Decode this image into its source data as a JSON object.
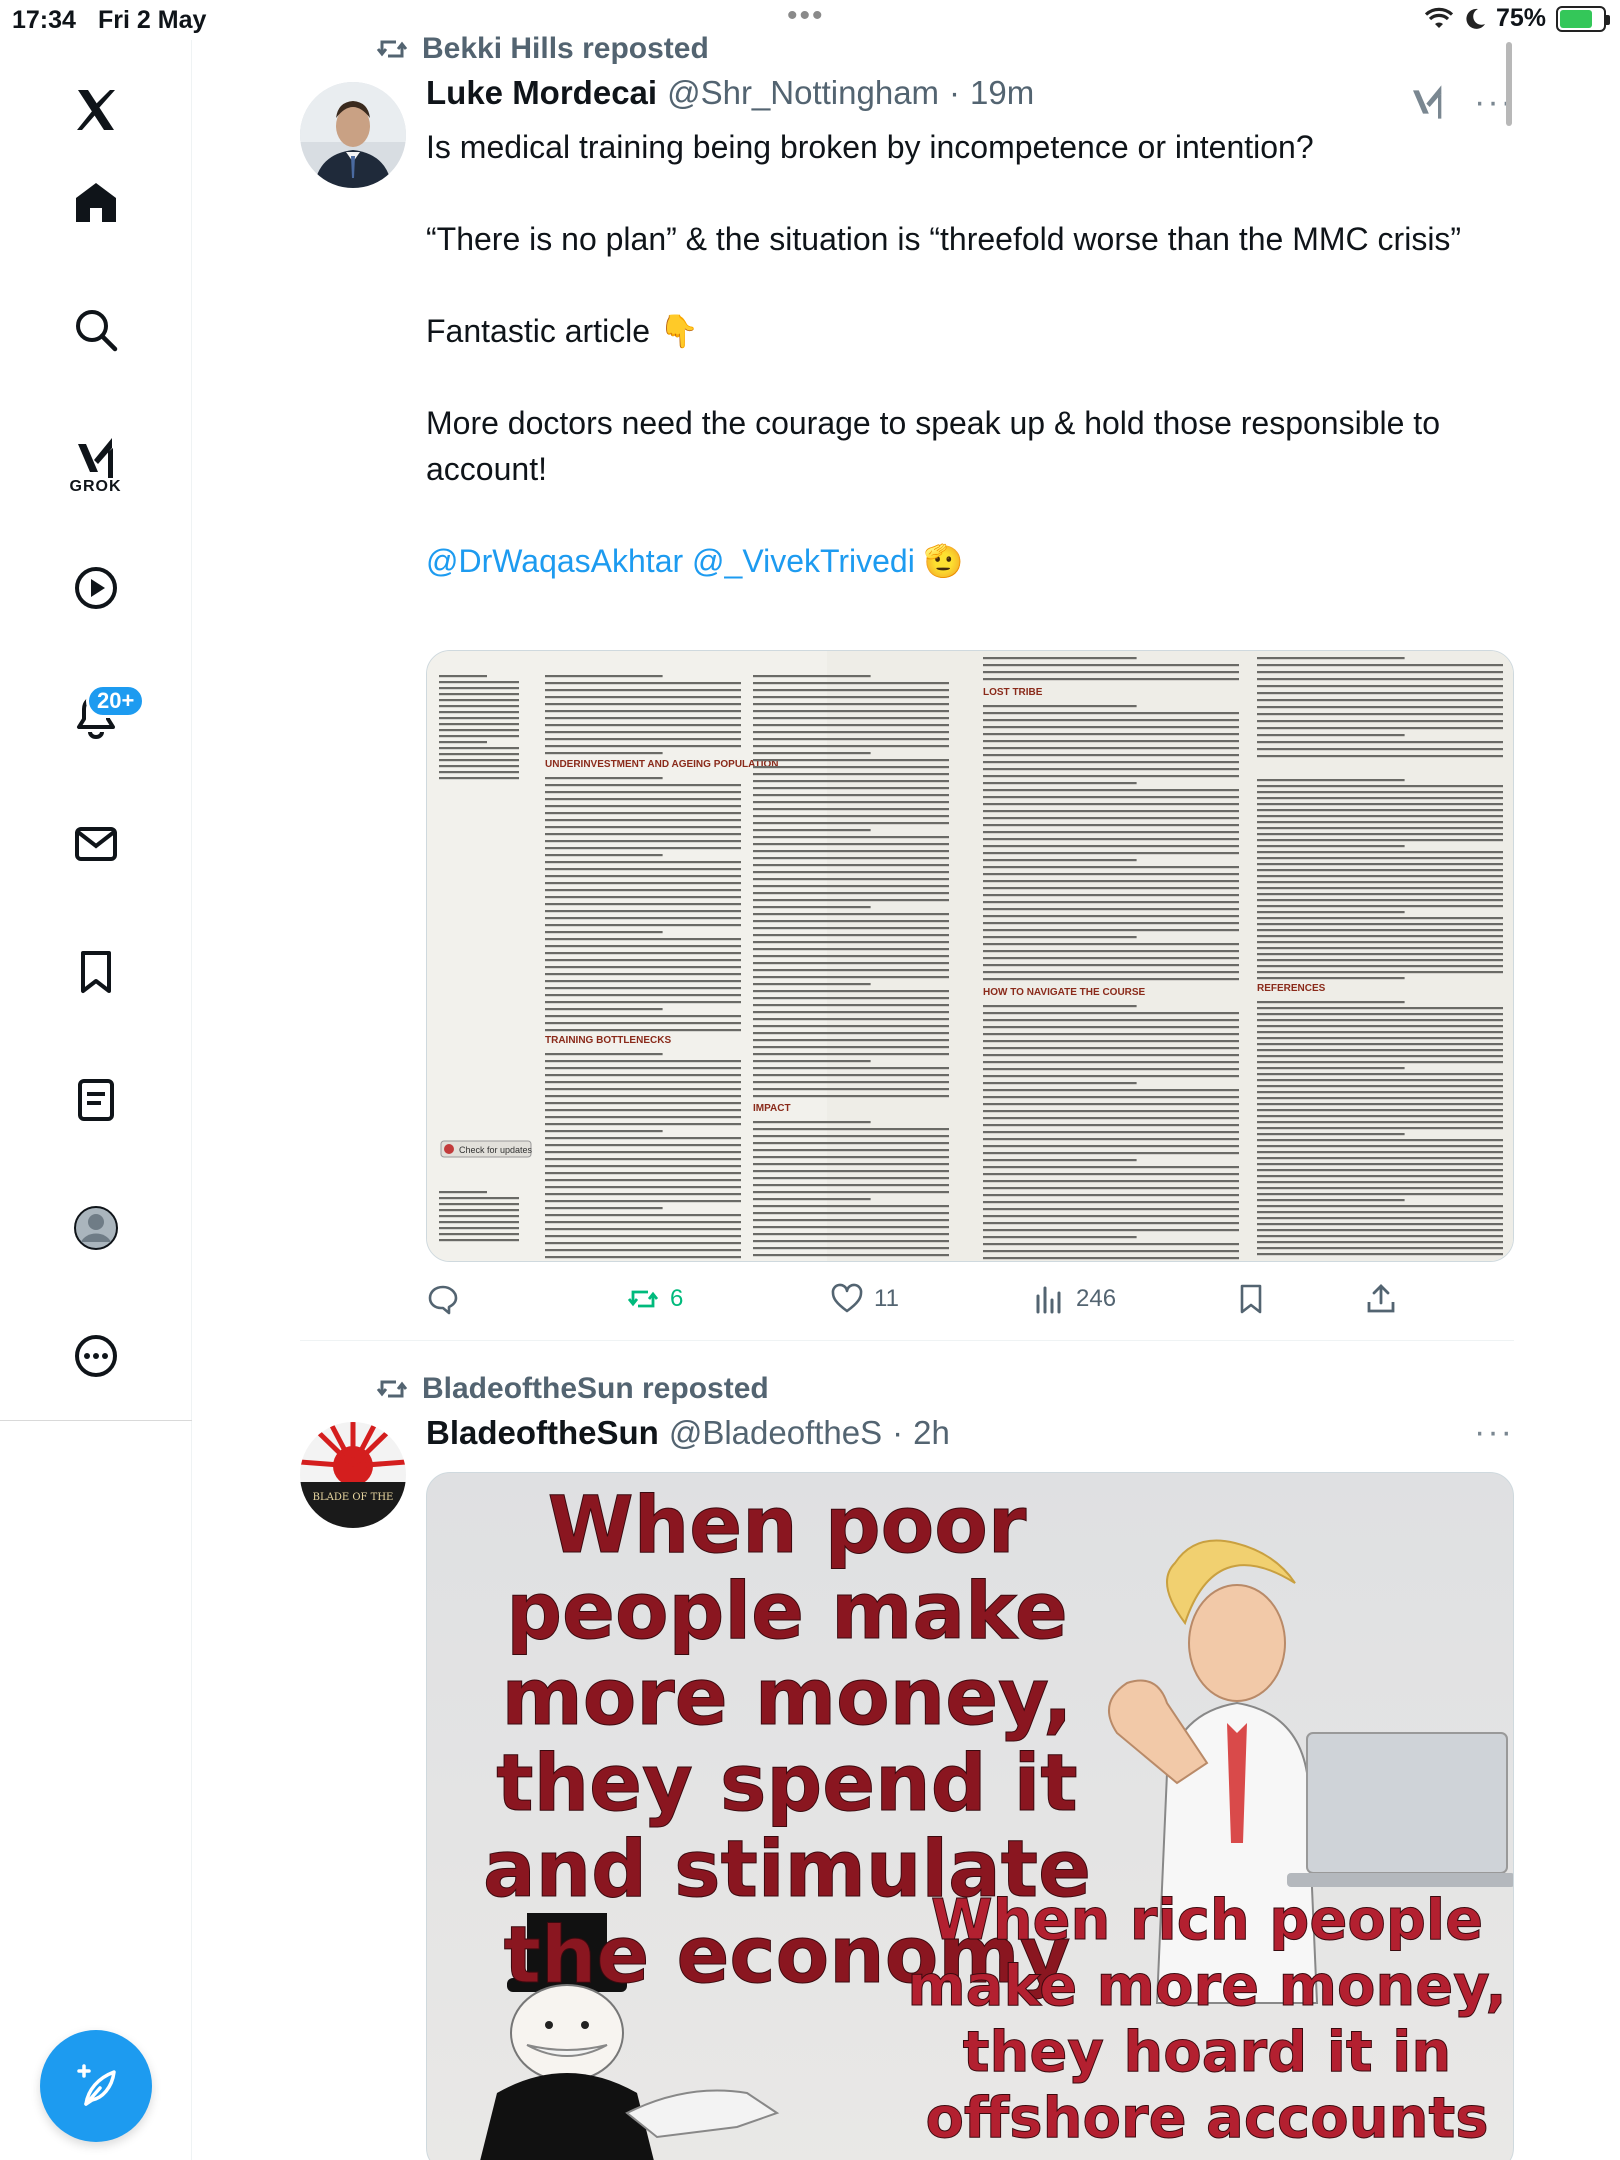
{
  "status_bar": {
    "time": "17:34",
    "date": "Fri 2 May",
    "battery": "75%"
  },
  "sidebar": {
    "grok_label": "GROK",
    "notifications_badge": "20+",
    "items": [
      "x-logo",
      "home",
      "search",
      "grok",
      "video",
      "notifications",
      "messages",
      "bookmarks",
      "lists",
      "profile",
      "more"
    ]
  },
  "tweet1": {
    "repost_by": "Bekki Hills reposted",
    "author_name": "Luke Mordecai",
    "handle": "@Shr_Nottingham",
    "time": "19m",
    "para1": "Is medical training being broken by incompetence or intention?",
    "para2": "“There is no plan” & the situation is “threefold worse than the MMC crisis”",
    "para3": "Fantastic article 👇",
    "para4": "More doctors need the courage to speak up & hold those responsible to account!",
    "mention1": "@DrWaqasAkhtar",
    "mention2": "@_VivekTrivedi",
    "mention_emoji": "🫡",
    "replies": "",
    "reposts": "6",
    "likes": "11",
    "views": "246",
    "article": {
      "h_underinvestment": "UNDERINVESTMENT AND AGEING POPULATION",
      "h_bottlenecks": "TRAINING BOTTLENECKS",
      "h_impact": "IMPACT",
      "h_lost_tribe": "LOST TRIBE",
      "h_navigate": "HOW TO NAVIGATE THE COURSE",
      "h_references": "REFERENCES",
      "check_updates": "Check for updates"
    }
  },
  "tweet2": {
    "repost_by": "BladeoftheSun reposted",
    "author_name": "BladeoftheSun",
    "handle": "@BladeoftheS",
    "time": "2h",
    "avatar_text": "BLADE OF THE",
    "meme_top": "When poor people make more money, they spend it and stimulate the economy",
    "meme_bottom": "When rich people make more money, they hoard it in offshore accounts"
  },
  "colors": {
    "accent": "#1d9bf0",
    "repost_green": "#00ba7c",
    "secondary_text": "#536471"
  }
}
